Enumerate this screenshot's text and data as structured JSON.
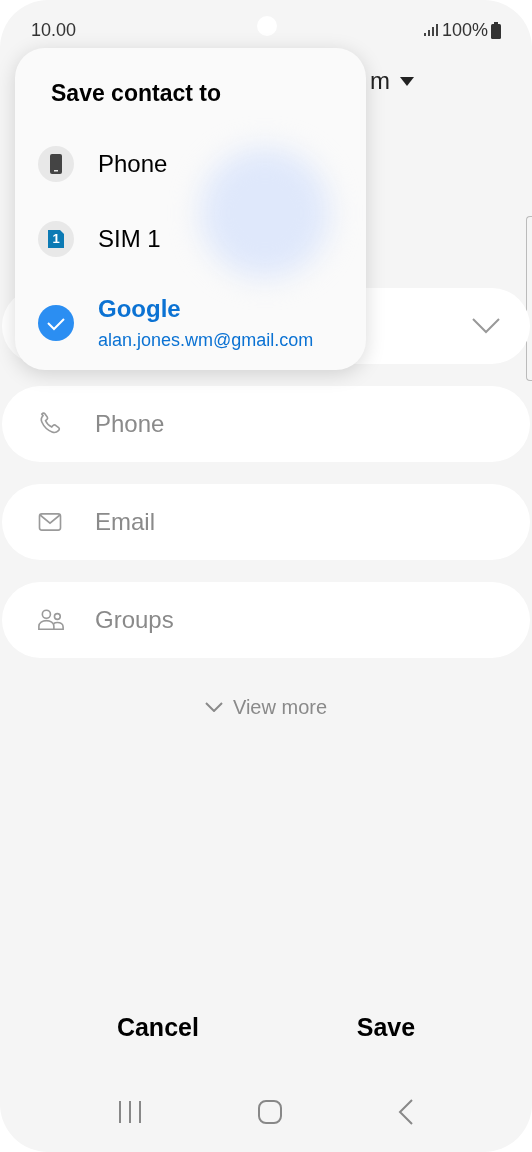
{
  "status_bar": {
    "time": "10.00",
    "battery": "100%"
  },
  "account_selector": {
    "label": "m"
  },
  "fields": [
    {
      "kind": "dropdown"
    },
    {
      "kind": "phone",
      "placeholder": "Phone"
    },
    {
      "kind": "email",
      "placeholder": "Email"
    },
    {
      "kind": "groups",
      "placeholder": "Groups"
    }
  ],
  "view_more": "View more",
  "popup": {
    "title": "Save contact to",
    "options": [
      {
        "kind": "phone",
        "label": "Phone",
        "selected": false
      },
      {
        "kind": "sim",
        "label": "SIM 1",
        "badge": "1",
        "selected": false
      },
      {
        "kind": "account",
        "label": "Google",
        "sublabel": "alan.jones.wm@gmail.com",
        "selected": true
      }
    ]
  },
  "buttons": [
    "Cancel",
    "Save"
  ]
}
